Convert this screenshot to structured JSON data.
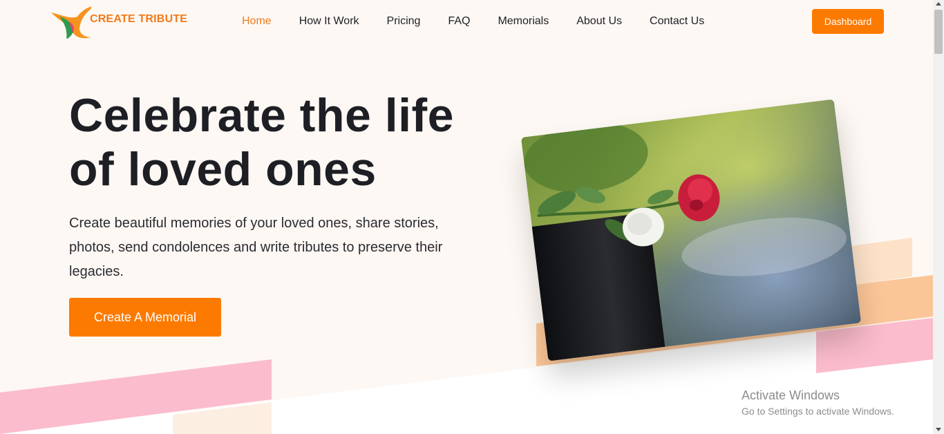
{
  "header": {
    "logo_text": "CREATE TRIBUTE",
    "nav": [
      {
        "label": "Home",
        "active": true
      },
      {
        "label": "How It Work"
      },
      {
        "label": "Pricing"
      },
      {
        "label": "FAQ"
      },
      {
        "label": "Memorials"
      },
      {
        "label": "About Us"
      },
      {
        "label": "Contact Us"
      }
    ],
    "dashboard_label": "Dashboard"
  },
  "hero": {
    "title_line1": "Celebrate the life",
    "title_line2": "of loved ones",
    "subtitle": "Create beautiful memories of your loved ones, share stories, photos, send condolences and write tributes to preserve their legacies.",
    "cta_label": "Create A Memorial"
  },
  "watermark": {
    "line1": "Activate Windows",
    "line2": "Go to Settings to activate Windows."
  },
  "colors": {
    "accent": "#fd7a01",
    "background": "#fdf8f4",
    "pink": "#fbbccd",
    "peach": "#fbc697"
  }
}
